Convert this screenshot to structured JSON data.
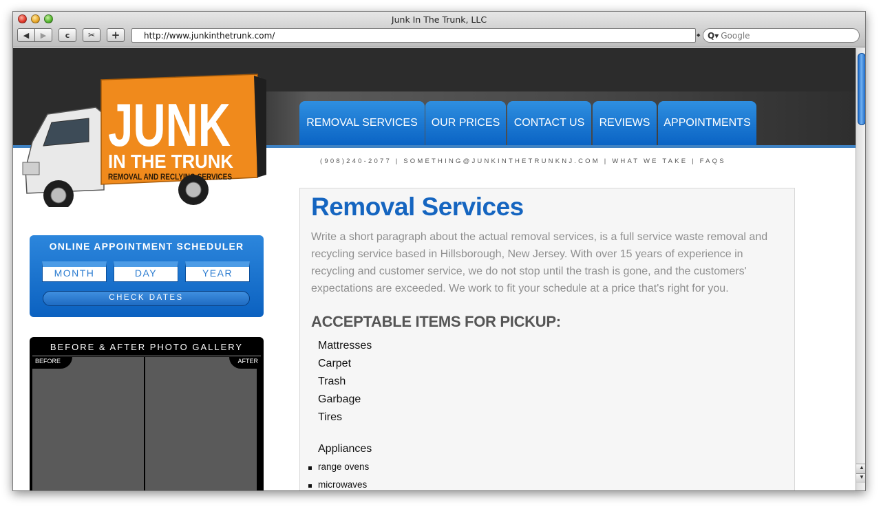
{
  "window": {
    "title": "Junk In The Trunk, LLC",
    "url": "http://www.junkinthetrunk.com/",
    "search_placeholder": "Google",
    "search_icon": "Q▾"
  },
  "toolbar": {
    "back_glyph": "◀",
    "forward_glyph": "▶",
    "reload_glyph": "c",
    "snip_glyph": "✂",
    "add_glyph": "+"
  },
  "logo": {
    "word1": "JUNK",
    "word2": "IN THE TRUNK",
    "tagline": "REMOVAL AND RECLYING SERVICES"
  },
  "nav": {
    "items": [
      "REMOVAL SERVICES",
      "OUR PRICES",
      "CONTACT US",
      "REVIEWS",
      "APPOINTMENTS"
    ]
  },
  "contact_line": "(908)240-2077 | SOMETHING@JUNKINTHETRUNKNJ.COM | WHAT  WE  TAKE | FAQS",
  "scheduler": {
    "title": "ONLINE APPOINTMENT SCHEDULER",
    "month": "MONTH",
    "day": "DAY",
    "year": "YEAR",
    "check": "CHECK DATES"
  },
  "gallery": {
    "title": "BEFORE & AFTER PHOTO GALLERY",
    "before": "BEFORE",
    "after": "AFTER"
  },
  "content": {
    "heading": "Removal Services",
    "paragraph": "Write a short paragraph about the actual removal services, is a full service waste removal and recycling service based in Hillsborough, New Jersey. With over 15 years of experience in recycling and customer service, we do not stop until the trash is gone, and the customers' expectations are exceeded. We work to fit your schedule at a price that's right for you.",
    "items_heading": "ACCEPTABLE ITEMS FOR PICKUP:",
    "items": [
      "Mattresses",
      "Carpet",
      "Trash",
      "Garbage",
      "Tires"
    ],
    "appliances": "Appliances",
    "appliance_items": [
      "range ovens",
      "microwaves"
    ]
  },
  "colors": {
    "brand_blue": "#1565c0",
    "nav_blue": "#0a63c4",
    "logo_orange": "#f08a1c"
  }
}
